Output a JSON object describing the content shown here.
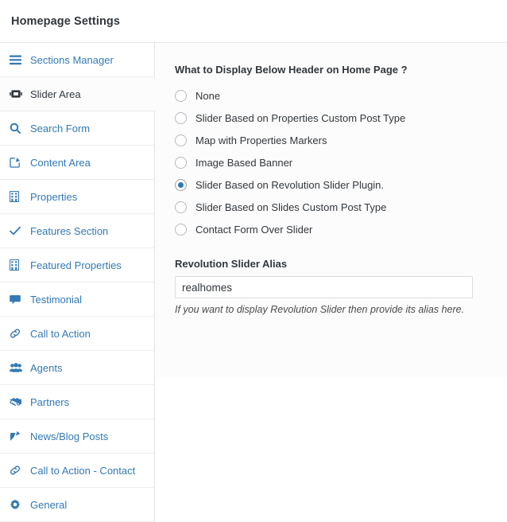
{
  "header": {
    "title": "Homepage Settings"
  },
  "sidebar": {
    "items": [
      {
        "label": "Sections Manager",
        "icon": "list-bars-icon",
        "active": false
      },
      {
        "label": "Slider Area",
        "icon": "slider-icon",
        "active": true
      },
      {
        "label": "Search Form",
        "icon": "search-icon",
        "active": false
      },
      {
        "label": "Content Area",
        "icon": "edit-square-icon",
        "active": false
      },
      {
        "label": "Properties",
        "icon": "building-icon",
        "active": false
      },
      {
        "label": "Features Section",
        "icon": "check-icon",
        "active": false
      },
      {
        "label": "Featured Properties",
        "icon": "building-icon",
        "active": false
      },
      {
        "label": "Testimonial",
        "icon": "comment-icon",
        "active": false
      },
      {
        "label": "Call to Action",
        "icon": "link-icon",
        "active": false
      },
      {
        "label": "Agents",
        "icon": "users-icon",
        "active": false
      },
      {
        "label": "Partners",
        "icon": "handshake-icon",
        "active": false
      },
      {
        "label": "News/Blog Posts",
        "icon": "pencil-square-icon",
        "active": false
      },
      {
        "label": "Call to Action - Contact",
        "icon": "link-icon",
        "active": false
      },
      {
        "label": "General",
        "icon": "gear-icon",
        "active": false
      }
    ]
  },
  "main": {
    "display_question": "What to Display Below Header on Home Page ?",
    "display_options": [
      {
        "label": "None",
        "checked": false
      },
      {
        "label": "Slider Based on Properties Custom Post Type",
        "checked": false
      },
      {
        "label": "Map with Properties Markers",
        "checked": false
      },
      {
        "label": "Image Based Banner",
        "checked": false
      },
      {
        "label": "Slider Based on Revolution Slider Plugin.",
        "checked": true
      },
      {
        "label": "Slider Based on Slides Custom Post Type",
        "checked": false
      },
      {
        "label": "Contact Form Over Slider",
        "checked": false
      }
    ],
    "alias_field": {
      "label": "Revolution Slider Alias",
      "value": "realhomes",
      "placeholder": "",
      "hint": "If you want to display Revolution Slider then provide its alias here."
    }
  },
  "colors": {
    "link_blue": "#3379b5",
    "accent_blue": "#2a7ab9",
    "text_dark": "#32373c",
    "panel_bg": "#fcfcfc",
    "border": "#e2e2e2"
  }
}
